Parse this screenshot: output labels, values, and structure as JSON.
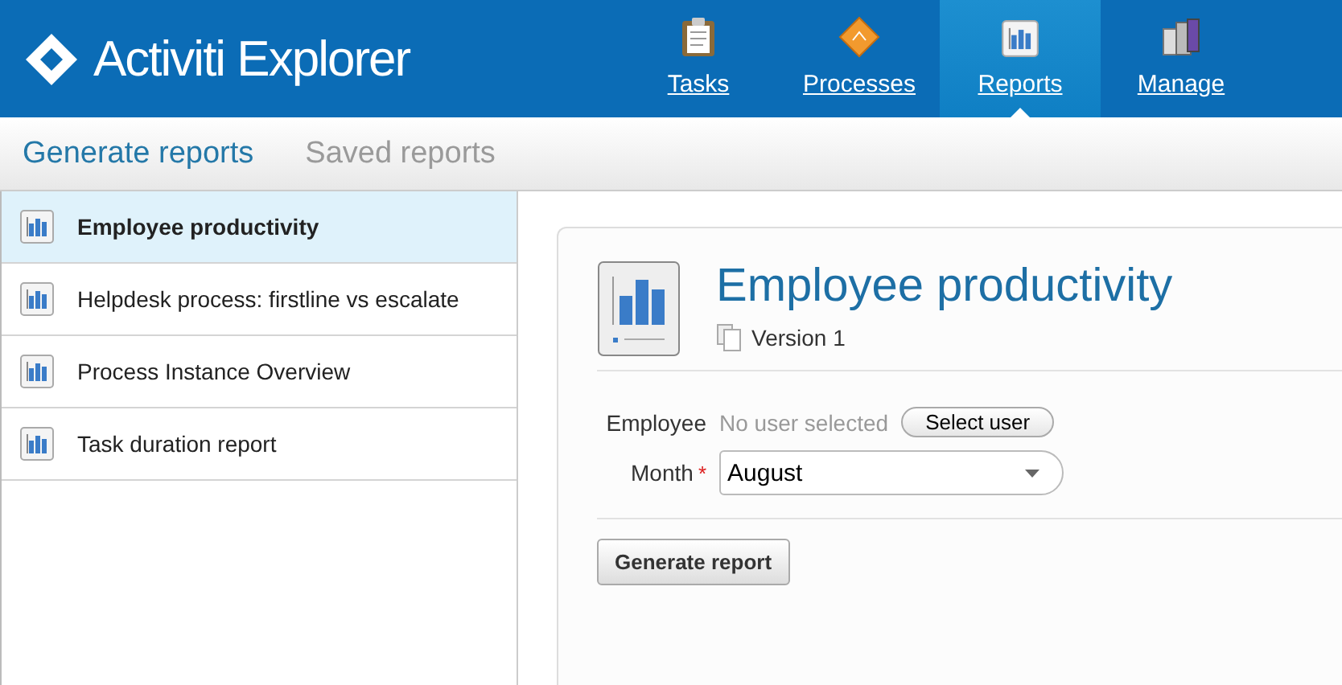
{
  "logo": {
    "text": "Activiti Explorer"
  },
  "nav": [
    {
      "label": "Tasks",
      "kind": "tasks",
      "selected": false
    },
    {
      "label": "Processes",
      "kind": "processes",
      "selected": false
    },
    {
      "label": "Reports",
      "kind": "reports",
      "selected": true
    },
    {
      "label": "Manage",
      "kind": "manage",
      "selected": false
    }
  ],
  "subnav": [
    {
      "label": "Generate reports",
      "selected": true
    },
    {
      "label": "Saved reports",
      "selected": false
    }
  ],
  "reports": [
    {
      "name": "Employee productivity",
      "selected": true
    },
    {
      "name": "Helpdesk process: firstline vs escalate",
      "selected": false
    },
    {
      "name": "Process Instance Overview",
      "selected": false
    },
    {
      "name": "Task duration report",
      "selected": false
    }
  ],
  "detail": {
    "title": "Employee productivity",
    "version": "Version 1",
    "employee": {
      "label": "Employee",
      "value": "No user selected",
      "button": "Select user"
    },
    "month": {
      "label": "Month",
      "required_mark": "*",
      "value": "August"
    },
    "submit": "Generate report"
  }
}
